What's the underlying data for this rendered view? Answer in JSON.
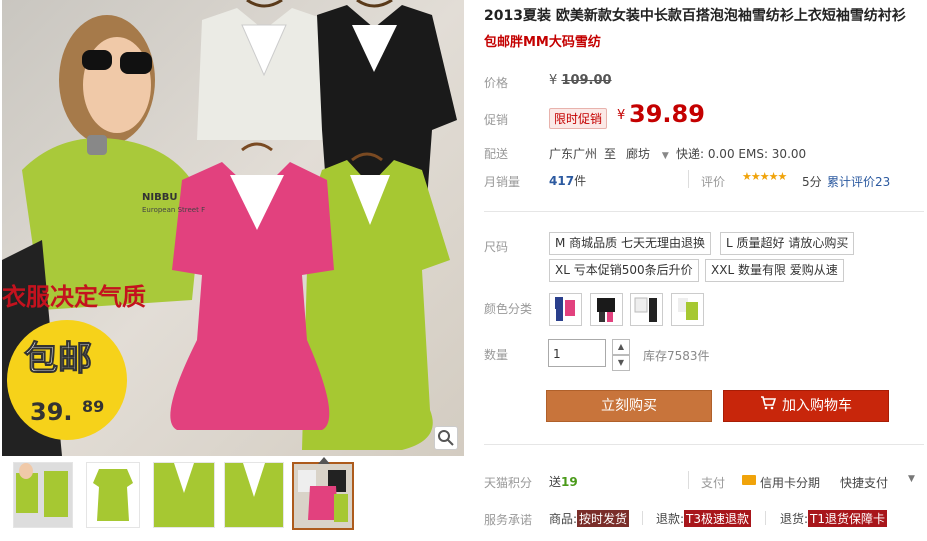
{
  "image_overlay": {
    "slogan": "衣服决定气质",
    "badge_top": "包邮",
    "badge_price": "39.",
    "badge_cents": "89",
    "label_brand": "NIBBU",
    "label_sub": "European Street F"
  },
  "product": {
    "title": "2013夏装 欧美新款女装中长款百搭泡泡袖雪纺衫上衣短袖雪纺衬衫",
    "subtitle": "包邮胖MM大码雪纺"
  },
  "price": {
    "label": "价格",
    "currency": "¥",
    "original": "109.00"
  },
  "promo": {
    "label": "促销",
    "tag": "限时促销",
    "currency": "¥",
    "price": "39.89"
  },
  "shipping": {
    "label": "配送",
    "from": "广东广州",
    "to_word": "至",
    "dest": "廊坊",
    "express": "快递: 0.00 EMS: 30.00"
  },
  "sales": {
    "label": "月销量",
    "count": "417",
    "unit": "件",
    "rating_label": "评价",
    "stars": 5,
    "score": "5分",
    "reviews": "累计评价23"
  },
  "size": {
    "label": "尺码",
    "options": [
      "M 商城品质 七天无理由退换",
      "L 质量超好 请放心购买",
      "XL 亏本促销500条后升价",
      "XXL 数量有限 爱购从速"
    ]
  },
  "color": {
    "label": "颜色分类",
    "options": [
      "rose",
      "black",
      "white",
      "green"
    ]
  },
  "quantity": {
    "label": "数量",
    "value": "1",
    "stock": "库存7583件"
  },
  "buttons": {
    "buy": "立刻购买",
    "cart": "加入购物车"
  },
  "points": {
    "label": "天猫积分",
    "text": "送",
    "value": "19"
  },
  "payment": {
    "label": "支付",
    "credit": "信用卡分期",
    "quick": "快捷支付"
  },
  "service": {
    "label": "服务承诺",
    "goods": "商品:",
    "goods_badge": "按时发货",
    "refund": "退款:",
    "refund_badge": "T3极速退款",
    "return": "退货:",
    "return_badge": "T1退货保障卡"
  },
  "colors": {
    "accent_red": "#c40000",
    "buy_btn": "#c8743b",
    "cart_btn": "#c8260b",
    "blouse_pink": "#e2417e",
    "blouse_green": "#a6c832",
    "blouse_black": "#1a1a1a",
    "blouse_white": "#ebebe5"
  }
}
